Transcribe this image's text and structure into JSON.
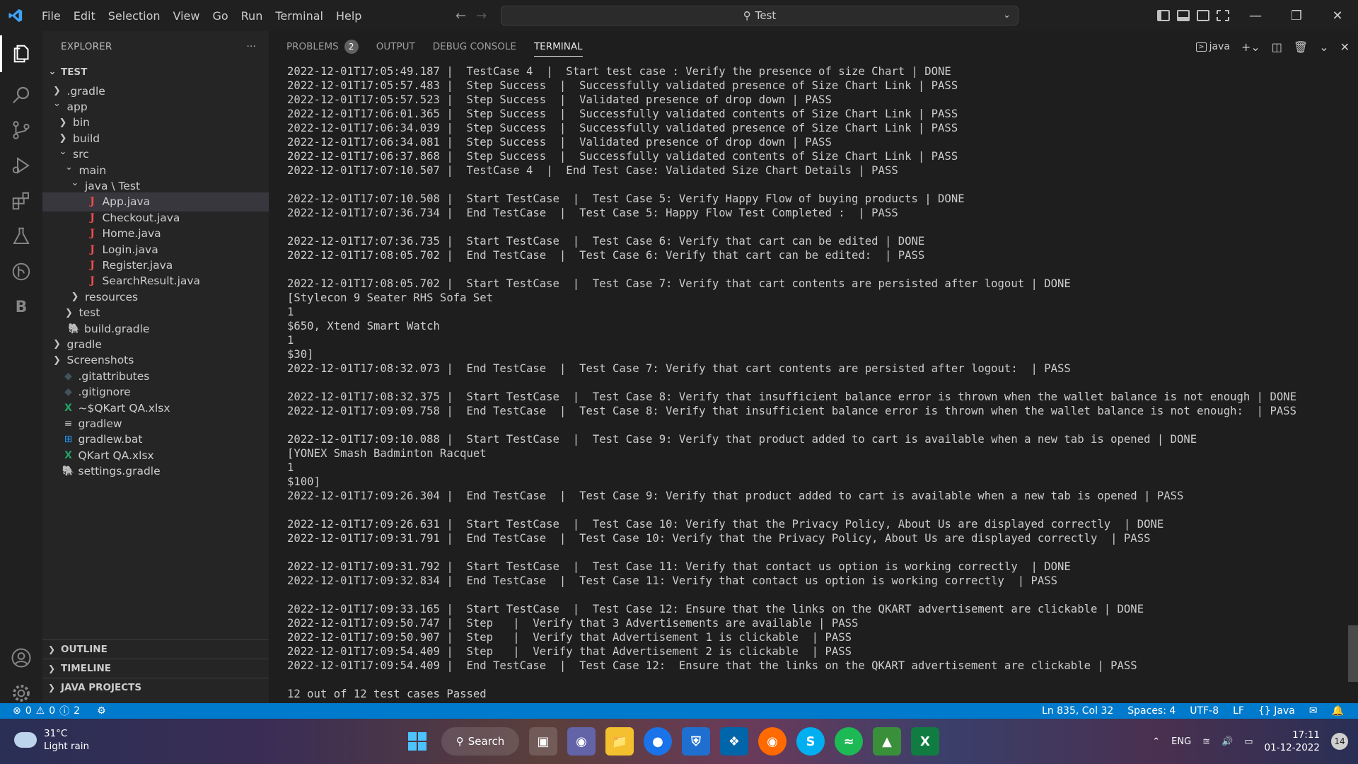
{
  "titlebar": {
    "menu": [
      "File",
      "Edit",
      "Selection",
      "View",
      "Go",
      "Run",
      "Terminal",
      "Help"
    ],
    "search_text": "Test"
  },
  "sidebar": {
    "title": "EXPLORER",
    "more": "···",
    "root": "TEST",
    "items": [
      {
        "label": ".gradle",
        "depth": 1,
        "kind": "folder",
        "open": false
      },
      {
        "label": "app",
        "depth": 1,
        "kind": "folder",
        "open": true
      },
      {
        "label": "bin",
        "depth": 2,
        "kind": "folder",
        "open": false
      },
      {
        "label": "build",
        "depth": 2,
        "kind": "folder",
        "open": false
      },
      {
        "label": "src",
        "depth": 2,
        "kind": "folder",
        "open": true
      },
      {
        "label": "main",
        "depth": 3,
        "kind": "folder",
        "open": true
      },
      {
        "label": "java \\ Test",
        "depth": 4,
        "kind": "folder",
        "open": true
      },
      {
        "label": "App.java",
        "depth": 5,
        "kind": "java",
        "selected": true
      },
      {
        "label": "Checkout.java",
        "depth": 5,
        "kind": "java"
      },
      {
        "label": "Home.java",
        "depth": 5,
        "kind": "java"
      },
      {
        "label": "Login.java",
        "depth": 5,
        "kind": "java"
      },
      {
        "label": "Register.java",
        "depth": 5,
        "kind": "java"
      },
      {
        "label": "SearchResult.java",
        "depth": 5,
        "kind": "java"
      },
      {
        "label": "resources",
        "depth": 4,
        "kind": "folder",
        "open": false
      },
      {
        "label": "test",
        "depth": 3,
        "kind": "folder",
        "open": false
      },
      {
        "label": "build.gradle",
        "depth": 2,
        "kind": "gradle"
      },
      {
        "label": "gradle",
        "depth": 1,
        "kind": "folder",
        "open": false
      },
      {
        "label": "Screenshots",
        "depth": 1,
        "kind": "folder",
        "open": false
      },
      {
        "label": ".gitattributes",
        "depth": 1,
        "kind": "git"
      },
      {
        "label": ".gitignore",
        "depth": 1,
        "kind": "git"
      },
      {
        "label": "~$QKart QA.xlsx",
        "depth": 1,
        "kind": "xlsx"
      },
      {
        "label": "gradlew",
        "depth": 1,
        "kind": "txt"
      },
      {
        "label": "gradlew.bat",
        "depth": 1,
        "kind": "win"
      },
      {
        "label": "QKart QA.xlsx",
        "depth": 1,
        "kind": "xlsx"
      },
      {
        "label": "settings.gradle",
        "depth": 1,
        "kind": "gradle"
      }
    ],
    "sections": [
      "OUTLINE",
      "TIMELINE",
      "JAVA PROJECTS"
    ]
  },
  "panel": {
    "tabs": [
      {
        "label": "PROBLEMS",
        "badge": "2"
      },
      {
        "label": "OUTPUT"
      },
      {
        "label": "DEBUG CONSOLE"
      },
      {
        "label": "TERMINAL",
        "active": true
      }
    ],
    "terminal_name": "java"
  },
  "terminal_lines": [
    "2022-12-01T17:05:49.187 |  TestCase 4  |  Start test case : Verify the presence of size Chart | DONE",
    "2022-12-01T17:05:57.483 |  Step Success  |  Successfully validated presence of Size Chart Link | PASS",
    "2022-12-01T17:05:57.523 |  Step Success  |  Validated presence of drop down | PASS",
    "2022-12-01T17:06:01.365 |  Step Success  |  Successfully validated contents of Size Chart Link | PASS",
    "2022-12-01T17:06:34.039 |  Step Success  |  Successfully validated presence of Size Chart Link | PASS",
    "2022-12-01T17:06:34.081 |  Step Success  |  Validated presence of drop down | PASS",
    "2022-12-01T17:06:37.868 |  Step Success  |  Successfully validated contents of Size Chart Link | PASS",
    "2022-12-01T17:07:10.507 |  TestCase 4  |  End Test Case: Validated Size Chart Details | PASS",
    "",
    "2022-12-01T17:07:10.508 |  Start TestCase  |  Test Case 5: Verify Happy Flow of buying products | DONE",
    "2022-12-01T17:07:36.734 |  End TestCase  |  Test Case 5: Happy Flow Test Completed :  | PASS",
    "",
    "2022-12-01T17:07:36.735 |  Start TestCase  |  Test Case 6: Verify that cart can be edited | DONE",
    "2022-12-01T17:08:05.702 |  End TestCase  |  Test Case 6: Verify that cart can be edited:  | PASS",
    "",
    "2022-12-01T17:08:05.702 |  Start TestCase  |  Test Case 7: Verify that cart contents are persisted after logout | DONE",
    "[Stylecon 9 Seater RHS Sofa Set",
    "1",
    "$650, Xtend Smart Watch",
    "1",
    "$30]",
    "2022-12-01T17:08:32.073 |  End TestCase  |  Test Case 7: Verify that cart contents are persisted after logout:  | PASS",
    "",
    "2022-12-01T17:08:32.375 |  Start TestCase  |  Test Case 8: Verify that insufficient balance error is thrown when the wallet balance is not enough | DONE",
    "2022-12-01T17:09:09.758 |  End TestCase  |  Test Case 8: Verify that insufficient balance error is thrown when the wallet balance is not enough:  | PASS",
    "",
    "2022-12-01T17:09:10.088 |  Start TestCase  |  Test Case 9: Verify that product added to cart is available when a new tab is opened | DONE",
    "[YONEX Smash Badminton Racquet",
    "1",
    "$100]",
    "2022-12-01T17:09:26.304 |  End TestCase  |  Test Case 9: Verify that product added to cart is available when a new tab is opened | PASS",
    "",
    "2022-12-01T17:09:26.631 |  Start TestCase  |  Test Case 10: Verify that the Privacy Policy, About Us are displayed correctly  | DONE",
    "2022-12-01T17:09:31.791 |  End TestCase  |  Test Case 10: Verify that the Privacy Policy, About Us are displayed correctly  | PASS",
    "",
    "2022-12-01T17:09:31.792 |  Start TestCase  |  Test Case 11: Verify that contact us option is working correctly  | DONE",
    "2022-12-01T17:09:32.834 |  End TestCase  |  Test Case 11: Verify that contact us option is working correctly  | PASS",
    "",
    "2022-12-01T17:09:33.165 |  Start TestCase  |  Test Case 12: Ensure that the links on the QKART advertisement are clickable | DONE",
    "2022-12-01T17:09:50.747 |  Step   |  Verify that 3 Advertisements are available | PASS",
    "2022-12-01T17:09:50.907 |  Step   |  Verify that Advertisement 1 is clickable  | PASS",
    "2022-12-01T17:09:54.409 |  Step   |  Verify that Advertisement 2 is clickable  | PASS",
    "2022-12-01T17:09:54.409 |  End TestCase  |  Test Case 12:  Ensure that the links on the QKART advertisement are clickable | PASS",
    "",
    "12 out of 12 test cases Passed"
  ],
  "statusbar": {
    "errors": "0",
    "warnings": "0",
    "info": "2",
    "position": "Ln 835, Col 32",
    "spaces": "Spaces: 4",
    "encoding": "UTF-8",
    "eol": "LF",
    "language": "Java"
  },
  "taskbar": {
    "temperature": "31°C",
    "weather": "Light rain",
    "search_label": "Search",
    "language": "ENG",
    "time": "17:11",
    "date": "01-12-2022",
    "notifications": "14"
  }
}
